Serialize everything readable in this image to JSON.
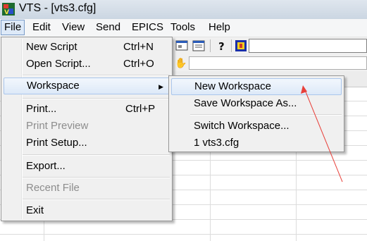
{
  "window": {
    "title": "VTS - [vts3.cfg]"
  },
  "menubar": {
    "items": [
      "File",
      "Edit",
      "View",
      "Send",
      "EPICS",
      "Tools",
      "Help"
    ]
  },
  "file_menu": {
    "items": [
      {
        "label": "New Script",
        "shortcut": "Ctrl+N",
        "disabled": false
      },
      {
        "label": "Open Script...",
        "shortcut": "Ctrl+O",
        "disabled": false
      },
      {
        "label": "Workspace",
        "shortcut": "",
        "disabled": false,
        "submenu": true,
        "highlighted": true
      },
      {
        "label": "Print...",
        "shortcut": "Ctrl+P",
        "disabled": false
      },
      {
        "label": "Print Preview",
        "shortcut": "",
        "disabled": true
      },
      {
        "label": "Print Setup...",
        "shortcut": "",
        "disabled": false
      },
      {
        "label": "Export...",
        "shortcut": "",
        "disabled": false
      },
      {
        "label": "Recent File",
        "shortcut": "",
        "disabled": true
      },
      {
        "label": "Exit",
        "shortcut": "",
        "disabled": false
      }
    ]
  },
  "workspace_menu": {
    "items": [
      {
        "label": "New Workspace",
        "highlighted": true
      },
      {
        "label": "Save Workspace As..."
      },
      {
        "label": "Switch Workspace..."
      },
      {
        "label": "1 vts3.cfg"
      }
    ]
  },
  "icons": {
    "app": "vts-app-icon",
    "toolbar": [
      "window-icon",
      "list-icon",
      "help-icon",
      "about-icon"
    ],
    "hand": "hand-icon"
  },
  "colors": {
    "highlight": "#dde9f8",
    "arrow": "#e8403a",
    "disabled_text": "#8d8d8d"
  }
}
